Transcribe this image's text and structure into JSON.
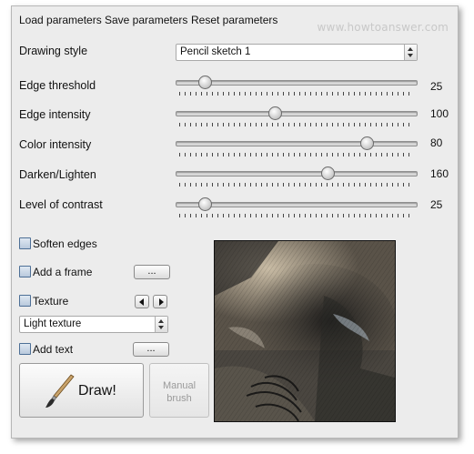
{
  "menu": {
    "load": "Load parameters",
    "save": "Save parameters",
    "reset": "Reset parameters"
  },
  "watermark": "www.howtoanswer.com",
  "drawing_style": {
    "label": "Drawing style",
    "value": "Pencil sketch 1"
  },
  "sliders": [
    {
      "label": "Edge threshold",
      "value": "25",
      "level": 0.1
    },
    {
      "label": "Edge intensity",
      "value": "100",
      "level": 0.4
    },
    {
      "label": "Color intensity",
      "value": "80",
      "level": 0.8
    },
    {
      "label": "Darken/Lighten",
      "value": "160",
      "level": 0.63
    },
    {
      "label": "Level of contrast",
      "value": "25",
      "level": 0.1
    }
  ],
  "options": {
    "soften_edges": "Soften edges",
    "add_frame": "Add a frame",
    "texture": "Texture",
    "texture_type": "Light texture",
    "add_text": "Add text",
    "ellipsis": "..."
  },
  "buttons": {
    "draw": "Draw!",
    "manual_line1": "Manual",
    "manual_line2": "brush"
  },
  "colors": {
    "panel": "#ececec",
    "checkbox": "#4d6f96"
  }
}
